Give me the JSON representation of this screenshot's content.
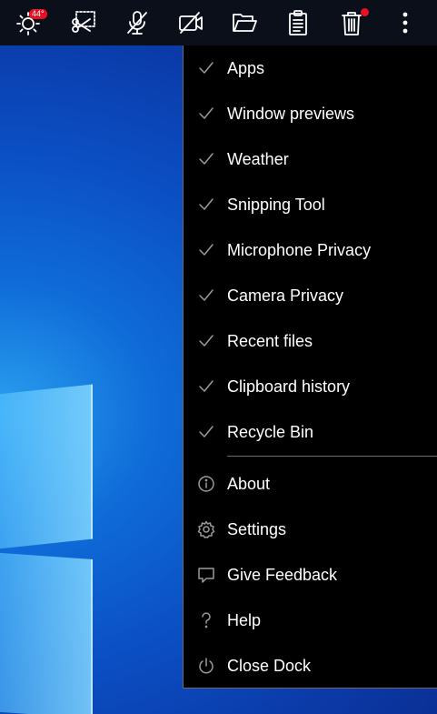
{
  "taskbar": {
    "weather_temp": "44°",
    "buttons": [
      "weather-icon",
      "snipping-tool-icon",
      "microphone-off-icon",
      "camera-off-icon",
      "folder-icon",
      "clipboard-icon",
      "recycle-bin-icon",
      "more-options-icon"
    ]
  },
  "menu": {
    "toggle_items": [
      {
        "label": "Apps",
        "checked": true
      },
      {
        "label": "Window previews",
        "checked": true
      },
      {
        "label": "Weather",
        "checked": true
      },
      {
        "label": "Snipping Tool",
        "checked": true
      },
      {
        "label": "Microphone Privacy",
        "checked": true
      },
      {
        "label": "Camera Privacy",
        "checked": true
      },
      {
        "label": "Recent files",
        "checked": true
      },
      {
        "label": "Clipboard history",
        "checked": true
      },
      {
        "label": "Recycle Bin",
        "checked": true
      }
    ],
    "action_items": [
      {
        "label": "About",
        "icon": "info-icon"
      },
      {
        "label": "Settings",
        "icon": "gear-icon"
      },
      {
        "label": "Give Feedback",
        "icon": "feedback-icon"
      },
      {
        "label": "Help",
        "icon": "help-icon"
      },
      {
        "label": "Close Dock",
        "icon": "power-icon"
      }
    ]
  },
  "colors": {
    "menu_bg": "#000000",
    "taskbar_bg": "#0b0f1a",
    "badge": "#e81123",
    "accent_desktop": "#0b4fc4"
  }
}
